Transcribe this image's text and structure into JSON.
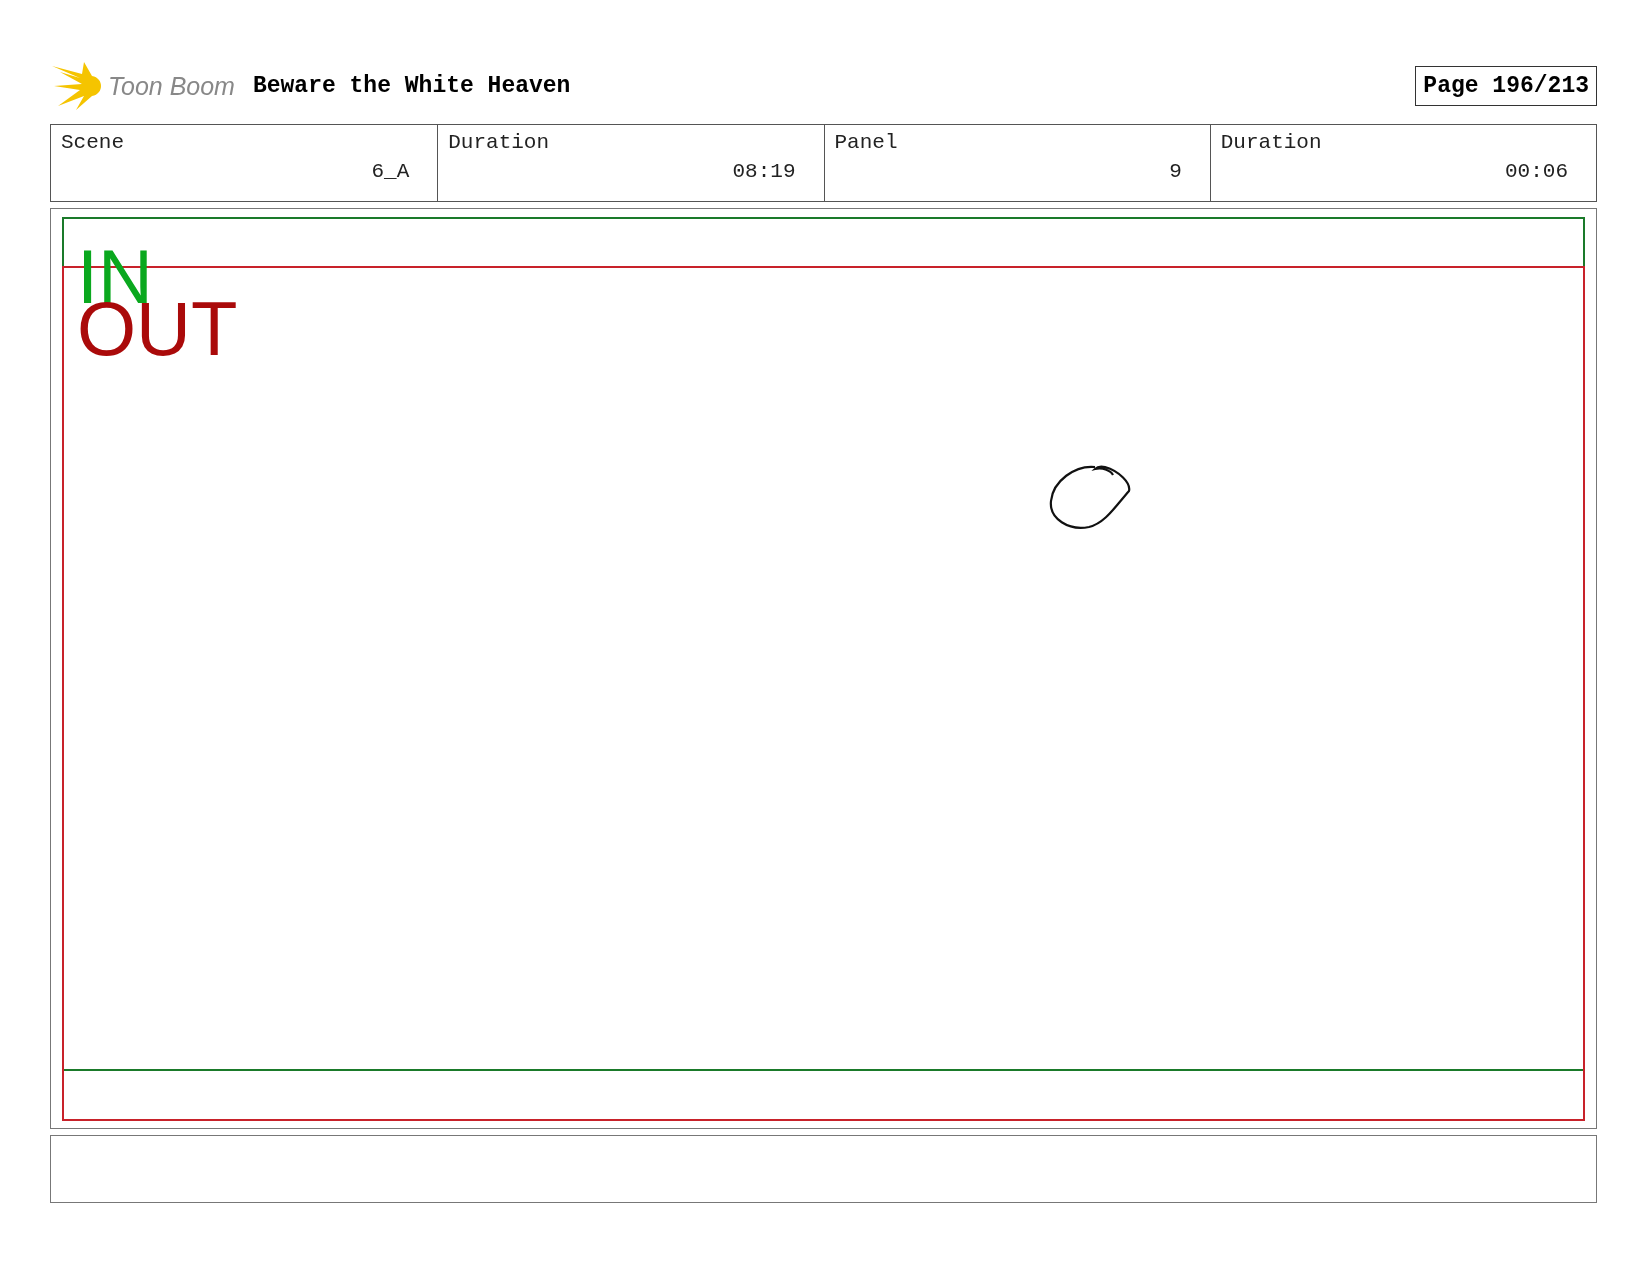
{
  "header": {
    "logo_text": "Toon Boom",
    "title": "Beware the White Heaven",
    "page": "Page 196/213"
  },
  "info": [
    {
      "label": "Scene",
      "value": "6_A"
    },
    {
      "label": "Duration",
      "value": "08:19"
    },
    {
      "label": "Panel",
      "value": "9"
    },
    {
      "label": "Duration",
      "value": "00:06"
    }
  ],
  "panel": {
    "in_label": "IN",
    "out_label": "OUT"
  }
}
